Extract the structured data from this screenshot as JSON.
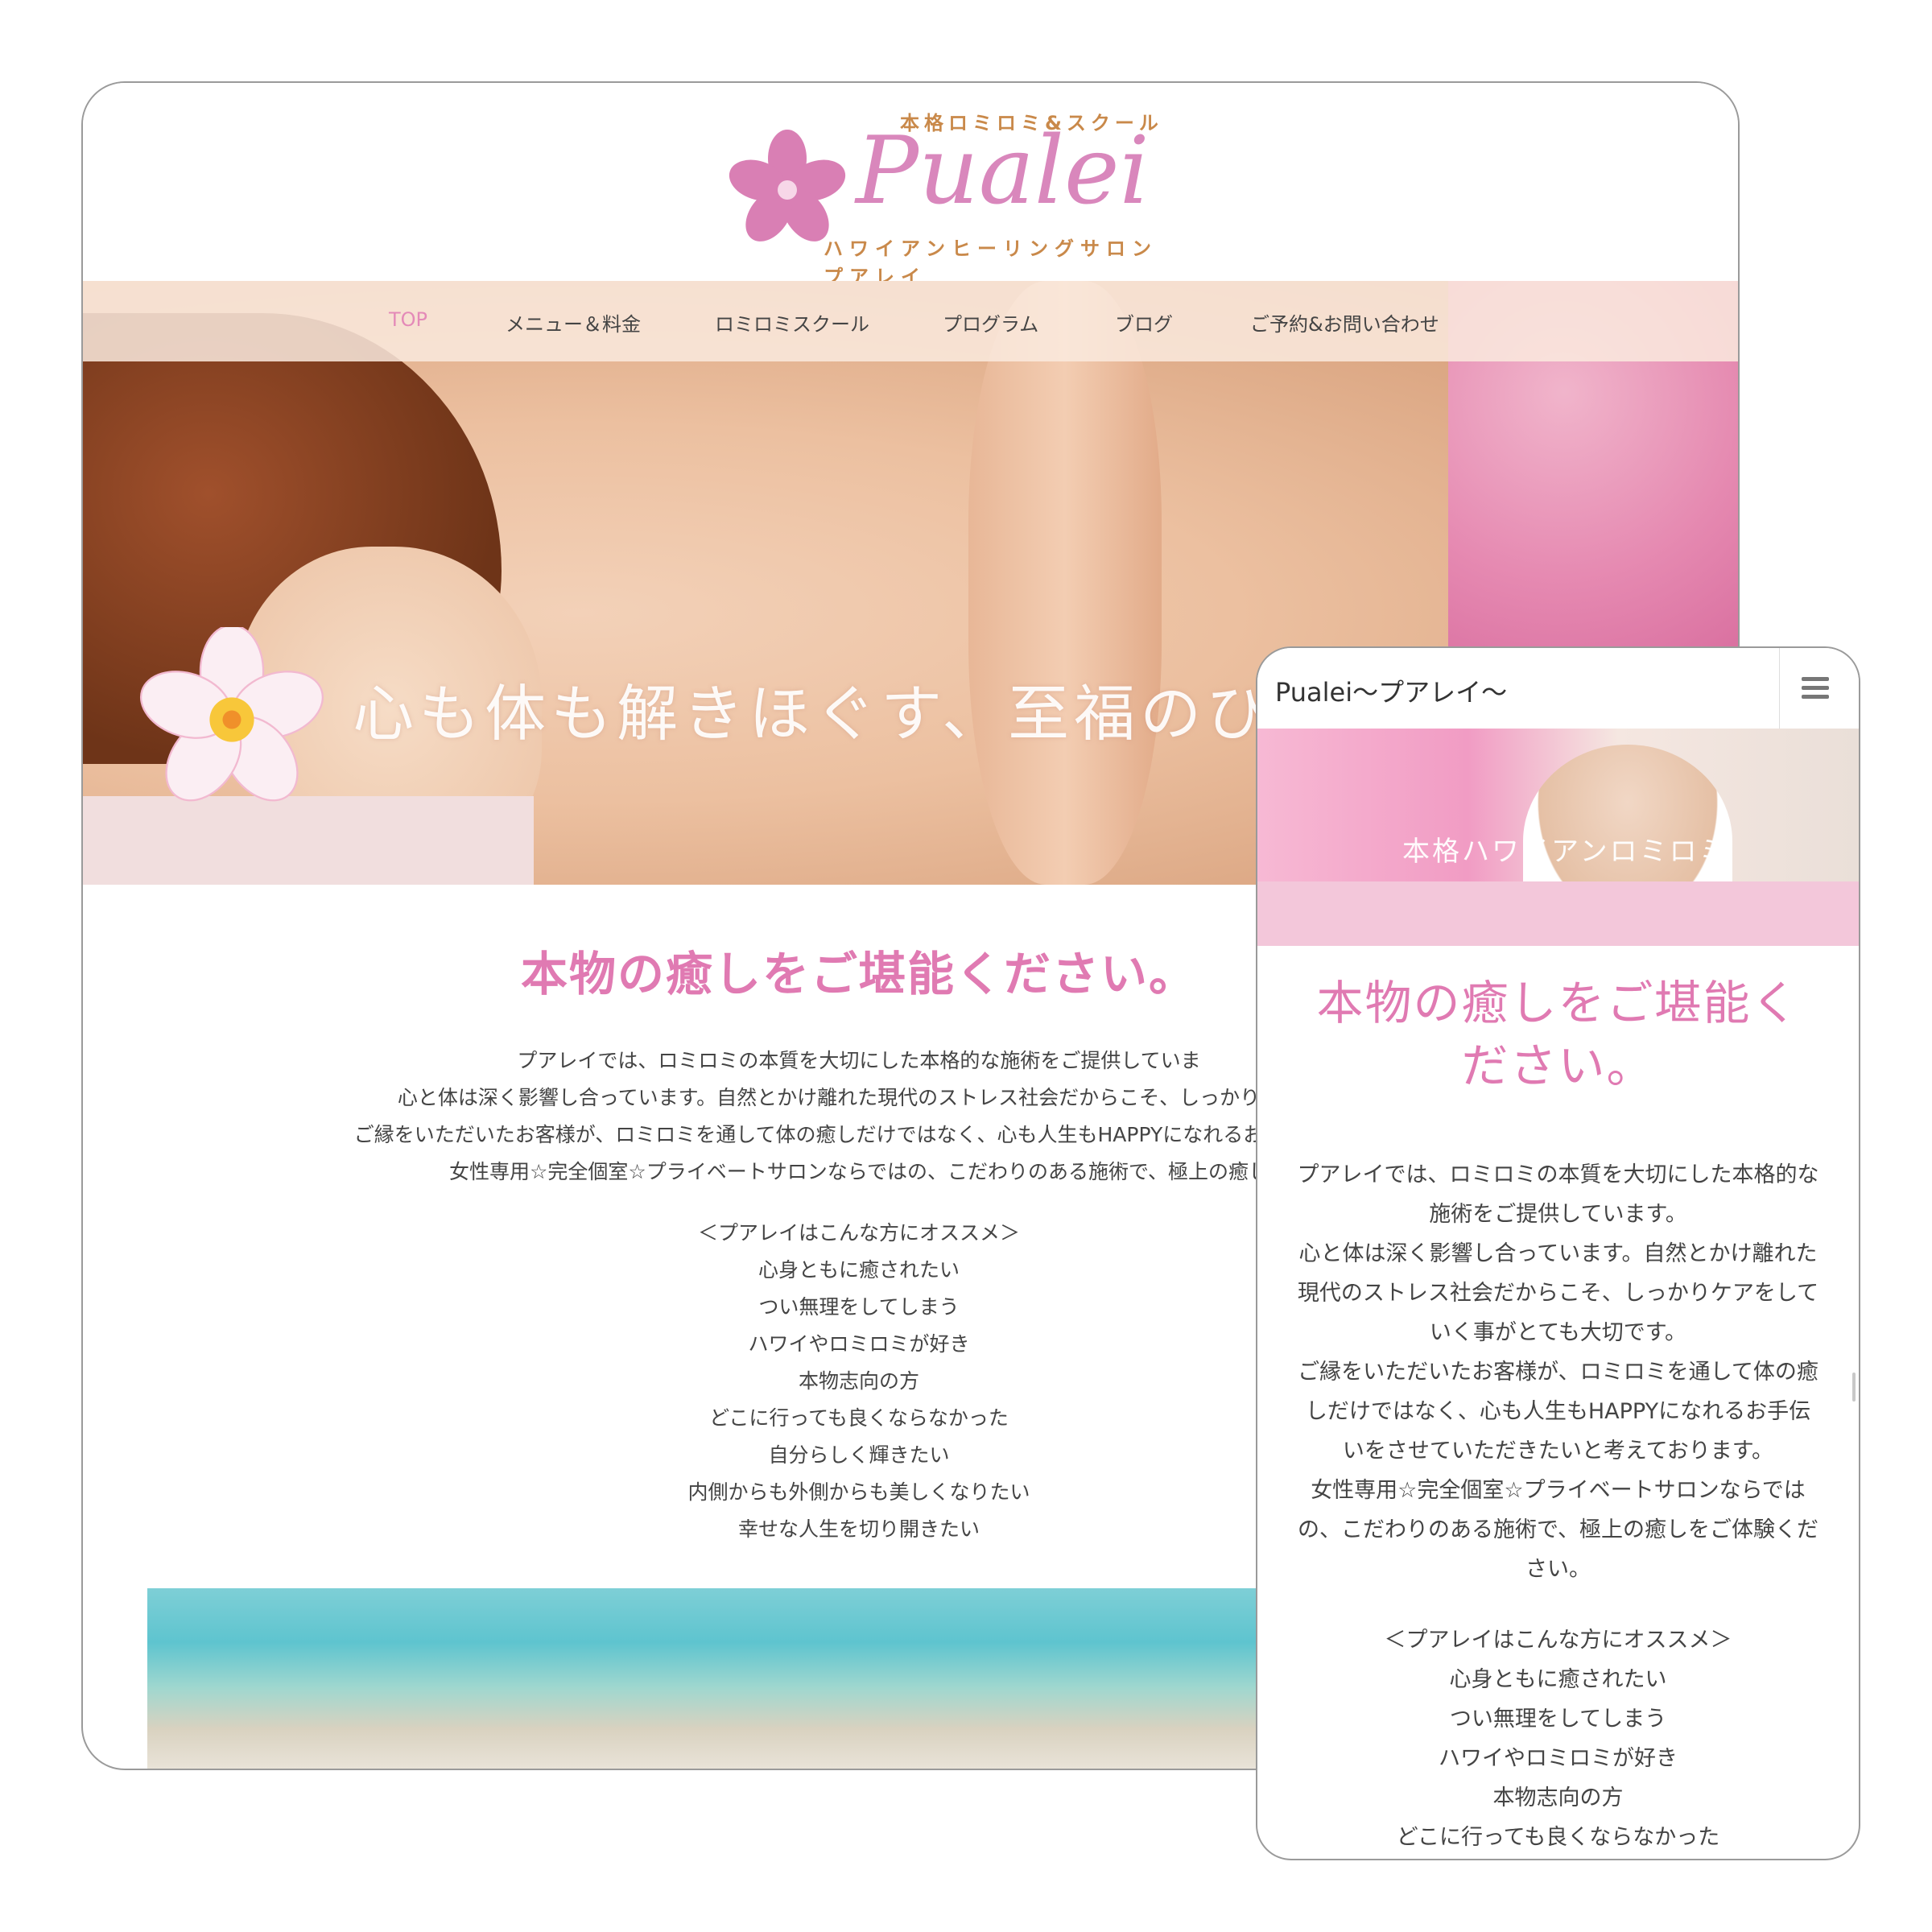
{
  "desktop": {
    "logo": {
      "tagline": "本格ロミロミ&スクール",
      "name": "Pualei",
      "subtitle": "ハワイアンヒーリングサロン プアレイ"
    },
    "nav": [
      "TOP",
      "メニュー＆料金",
      "ロミロミスクール",
      "プログラム",
      "ブログ",
      "ご予約&お問い合わせ"
    ],
    "nav_active": "TOP",
    "hero_title": "心も体も解きほぐす、至福のひととき",
    "heading": "本物の癒しをご堪能ください。",
    "paragraph": [
      "プアレイでは、ロミロミの本質を大切にした本格的な施術をご提供していま",
      "心と体は深く影響し合っています。自然とかけ離れた現代のストレス社会だからこそ、しっかりケアを",
      "ご縁をいただいたお客様が、ロミロミを通して体の癒しだけではなく、心も人生もHAPPYになれるお手伝いをさ",
      "女性専用☆完全個室☆プライベートサロンならではの、こだわりのある施術で、極上の癒し"
    ],
    "list": [
      "＜プアレイはこんな方にオススメ＞",
      "心身ともに癒されたい",
      "つい無理をしてしまう",
      "ハワイやロミロミが好き",
      "本物志向の方",
      "どこに行っても良くならなかった",
      "自分らしく輝きたい",
      "内側からも外側からも美しくなりたい",
      "幸せな人生を切り開きたい"
    ]
  },
  "mobile": {
    "title": "Pualei〜プアレイ〜",
    "hero_title": "本格ハワイアンロミロミ",
    "heading": [
      "本物の癒しをご堪能く",
      "ださい。"
    ],
    "paragraph": [
      "プアレイでは、ロミロミの本質を大切にした本格的な",
      "施術をご提供しています。",
      "心と体は深く影響し合っています。自然とかけ離れた",
      "現代のストレス社会だからこそ、しっかりケアをして",
      "いく事がとても大切です。",
      "ご縁をいただいたお客様が、ロミロミを通して体の癒",
      "しだけではなく、心も人生もHAPPYになれるお手伝",
      "いをさせていただきたいと考えております。",
      "女性専用☆完全個室☆プライベートサロンならでは",
      "の、こだわりのある施術で、極上の癒しをご体験くだ",
      "さい。"
    ],
    "list": [
      "＜プアレイはこんな方にオススメ＞",
      "心身ともに癒されたい",
      "つい無理をしてしまう",
      "ハワイやロミロミが好き",
      "本物志向の方",
      "どこに行っても良くならなかった"
    ]
  },
  "colors": {
    "accent_pink": "#e07ab2",
    "nav_active": "#e48ab8",
    "logo_gold": "#c9894a"
  }
}
